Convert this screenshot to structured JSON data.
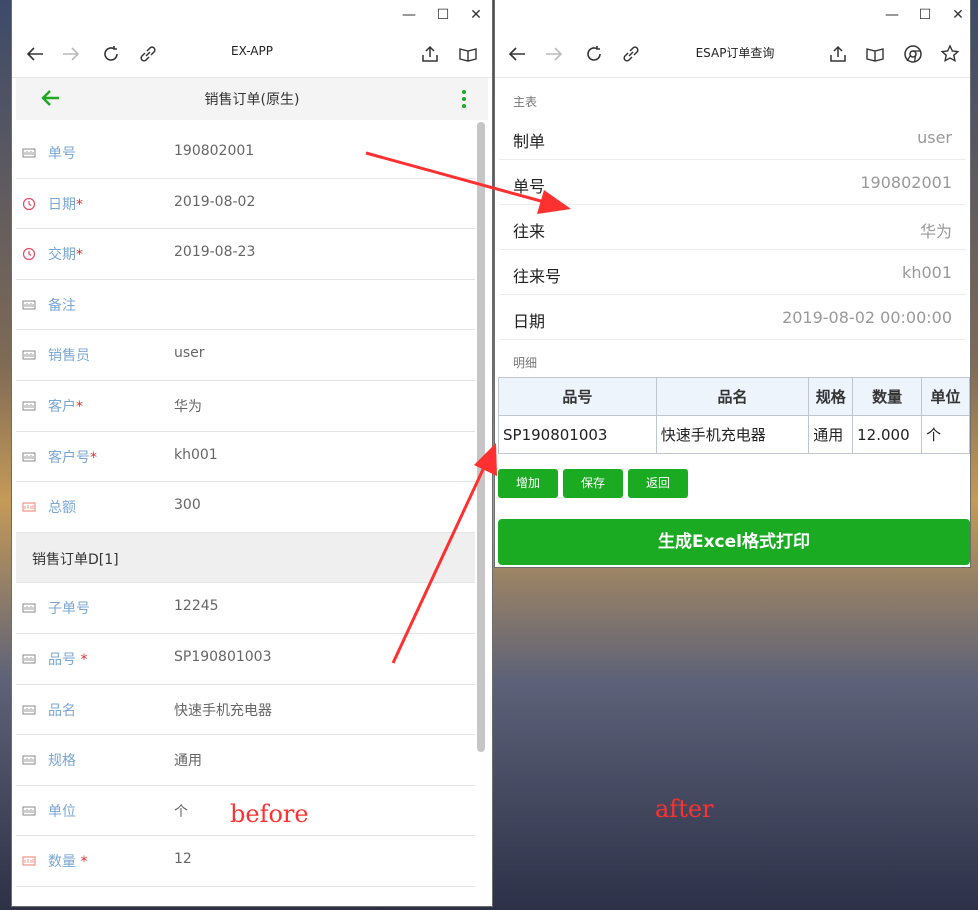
{
  "left_window": {
    "browser_title": "EX-APP",
    "app_title": "销售订单(原生)",
    "section_title": "销售订单D[1]",
    "fields_main": [
      {
        "label": "单号",
        "required": false,
        "value": "190802001",
        "icon": "text-field-icon"
      },
      {
        "label": "日期",
        "required": true,
        "value": "2019-08-02",
        "icon": "clock-icon"
      },
      {
        "label": "交期",
        "required": true,
        "value": "2019-08-23",
        "icon": "clock-icon"
      },
      {
        "label": "备注",
        "required": false,
        "value": "",
        "icon": "text-field-icon"
      },
      {
        "label": "销售员",
        "required": false,
        "value": "user",
        "icon": "text-field-icon"
      },
      {
        "label": "客户",
        "required": true,
        "value": "华为",
        "icon": "text-field-icon"
      },
      {
        "label": "客户号",
        "required": true,
        "value": "kh001",
        "icon": "text-field-icon"
      },
      {
        "label": "总额",
        "required": false,
        "value": "300",
        "icon": "number-field-icon"
      }
    ],
    "fields_detail": [
      {
        "label": "子单号",
        "required": false,
        "value": "12245",
        "icon": "text-field-icon"
      },
      {
        "label": "品号 ",
        "required": true,
        "value": "SP190801003",
        "icon": "text-field-icon"
      },
      {
        "label": "品名",
        "required": false,
        "value": "快速手机充电器",
        "icon": "text-field-icon"
      },
      {
        "label": "规格",
        "required": false,
        "value": "通用",
        "icon": "text-field-icon"
      },
      {
        "label": "单位",
        "required": false,
        "value": "个",
        "icon": "text-field-icon"
      },
      {
        "label": "数量 ",
        "required": true,
        "value": "12",
        "icon": "number-field-icon"
      }
    ],
    "required_mark": "*",
    "annotation": "before"
  },
  "right_window": {
    "browser_title": "ESAP订单查询",
    "master_label": "主表",
    "master_rows": [
      {
        "key": "制单",
        "value": "user"
      },
      {
        "key": "单号",
        "value": "190802001"
      },
      {
        "key": "往来",
        "value": "华为"
      },
      {
        "key": "往来号",
        "value": "kh001"
      },
      {
        "key": "日期",
        "value": "2019-08-02 00:00:00"
      }
    ],
    "detail_label": "明细",
    "table": {
      "headers": [
        "品号",
        "品名",
        "规格",
        "数量",
        "单位"
      ],
      "rows": [
        [
          "SP190801003",
          "快速手机充电器",
          "通用",
          "12.000",
          "个"
        ]
      ]
    },
    "buttons": {
      "add": "增加",
      "save": "保存",
      "back": "返回"
    },
    "print_button": "生成Excel格式打印",
    "annotation": "after"
  },
  "window_controls": {
    "minimize": "—",
    "maximize": "☐",
    "close": "✕"
  },
  "colors": {
    "accent_green": "#1aab23",
    "label_blue": "#7aa7d4",
    "arrow_red": "#ff3030"
  }
}
